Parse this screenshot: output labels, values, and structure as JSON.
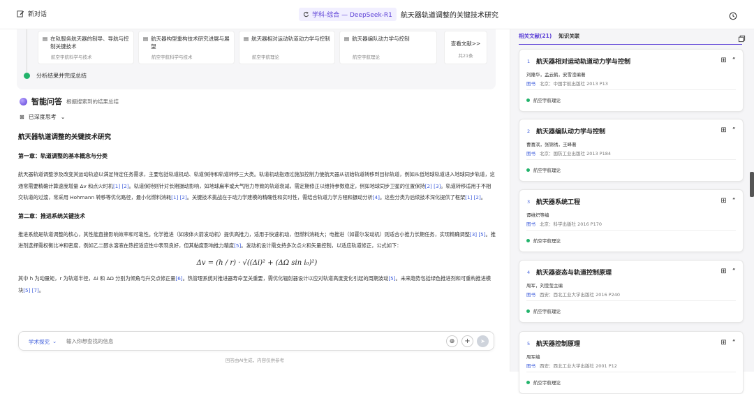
{
  "topbar": {
    "new_chat": "新对话",
    "badge": "学科-综合 — DeepSeek-R1",
    "title": "航天器轨道调整的关键技术研究"
  },
  "search": {
    "refs": [
      {
        "title": "在轨服务航天器的制导、导航与控制关键技术",
        "sub": "航空宇航科学与技术"
      },
      {
        "title": "航天器构型重构技术研究进展与展望",
        "sub": "航空宇航科学与技术"
      },
      {
        "title": "航天器相对运动轨道动力学与控制",
        "sub": "航空宇航理论"
      },
      {
        "title": "航天器编队动力学与控制",
        "sub": "航空宇航理论"
      }
    ],
    "more_label": "查看文献>>",
    "more_count": "共21条",
    "done_text": "分析结果并完成总结"
  },
  "answer": {
    "title": "智能问答",
    "subtitle": "根据搜索到的结果总结",
    "deep_label": "已深度思考"
  },
  "article": {
    "heading": "航天器轨道调整的关键技术研究",
    "ch1_title": "第一章：轨道调整的基本概念与分类",
    "ch1_p1": "航天器轨道调整涉及改变其运动轨迹以满足特定任务需求，主要包括轨道机动、轨道保持和轨道转移三大类。轨道机动指通过施加控制力使航天器从初始轨道转移到目标轨道，例如从低地球轨道进入地球同步轨道，这通常需要精确计算速度增量 Δv 和点火时机",
    "ch1_p1_cite1": "[1] [2]",
    "ch1_p1_b": "。轨道保持则针对长期摄动影响，如地球扁率或大气阻力导致的轨道衰减，需定期修正以维持参数稳定，例如地球同步卫星的位置保持",
    "ch1_p1_cite2": "[2] [3]",
    "ch1_p1_c": "。轨道转移适用于不相交轨道的过渡，常采用 Hohmann 转移等优化路径，最小化燃料消耗",
    "ch1_p1_cite3": "[1] [2]",
    "ch1_p1_d": "。关键技术挑战在于动力学建模的精确性和实时性，需结合轨道力学方程和摄动分析",
    "ch1_p1_cite4": "[4]",
    "ch1_p1_e": "。这些分类为后续技术深化提供了框架",
    "ch1_p1_cite5": "[1] [2]",
    "ch1_p1_f": "。",
    "ch2_title": "第二章：推进系统关键技术",
    "ch2_p1": "推进系统是轨道调整的核心，其性能直接影响效率和可靠性。化学推进（如液体火箭发动机）提供高推力，适用于快速机动，但燃料消耗大；电推进（如霍尔发动机）则适合小推力长期任务，实现精确调整",
    "ch2_p1_cite1": "[3] [5]",
    "ch2_p1_b": "。推进剂选择需权衡比冲和密度，例如乙二醇水溶液在热控适应性中表现良好，但其黏度影响推力精度",
    "ch2_p1_cite2": "[5]",
    "ch2_p1_c": "。发动机设计需支持多次点火和矢量控制，以适应轨道修正，公式如下：",
    "formula": "Δv = (h / r) · √((Δi)² + (ΔΩ sin i₀)²)",
    "ch2_p2": "其中 h 为动量矩，r 为轨道半径，Δi 和 ΔΩ 分别为倾角与升交点修正量",
    "ch2_p2_cite1": "[6]",
    "ch2_p2_b": "。热管理系统对推进器寿命至关重要，需优化辐射器设计以应对轨道高度变化引起的周期波动",
    "ch2_p2_cite2": "[5]",
    "ch2_p2_c": "。未来趋势包括绿色推进剂和可重构推进模块",
    "ch2_p2_cite3": "[5] [7]",
    "ch2_p2_d": "。"
  },
  "input": {
    "mode": "学术探究",
    "placeholder": "输入你想查找的信息",
    "footer": "回答由AI生成，内容仅供参考"
  },
  "right": {
    "tab_refs": "相关文献(21)",
    "tab_kg": "知识关联",
    "cards": [
      {
        "num": "1",
        "title": "航天器相对运动轨道动力学与控制",
        "authors": "刘隆华，孟云鹤，安雪滢编著",
        "type": "图书",
        "pub": "北京：中国宇航出版社 2013 P13",
        "tag": "航空宇航理论"
      },
      {
        "num": "2",
        "title": "航天器编队动力学与控制",
        "authors": "曹喜滨，张锦绣，王峰著",
        "type": "图书",
        "pub": "北京：国防工业出版社 2013 P184",
        "tag": "航空宇航理论"
      },
      {
        "num": "3",
        "title": "航天器系统工程",
        "authors": "谭维炽等编",
        "type": "图书",
        "pub": "北京：科学出版社 2016 P170",
        "tag": "航空宇航理论"
      },
      {
        "num": "4",
        "title": "航天器姿态与轨道控制原理",
        "authors": "周军，刘莹莹主编",
        "type": "图书",
        "pub": "西安：西北工业大学出版社 2016 P240",
        "tag": "航空宇航理论"
      },
      {
        "num": "5",
        "title": "航天器控制原理",
        "authors": "周军编",
        "type": "图书",
        "pub": "西安：西北工业大学出版社 2001 P12",
        "tag": "航空宇航理论"
      }
    ]
  }
}
